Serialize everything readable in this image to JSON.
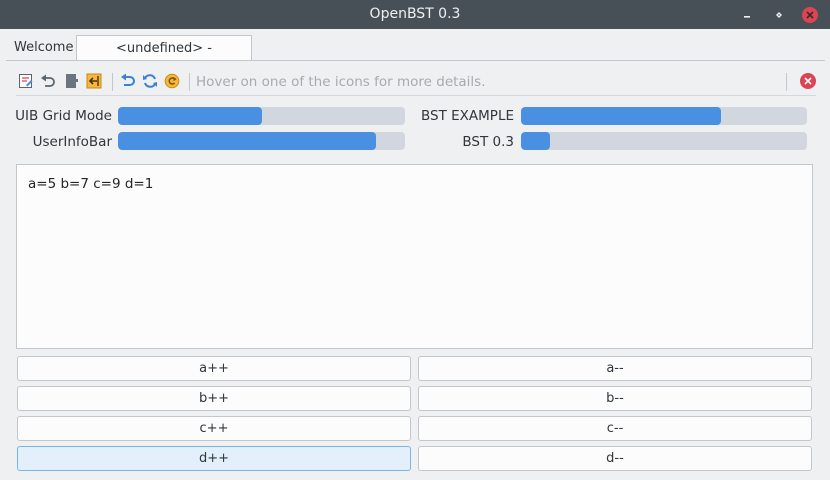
{
  "window": {
    "title": "OpenBST 0.3"
  },
  "tabs": [
    {
      "label": "Welcome"
    },
    {
      "label": "<undefined> - <unknown>"
    }
  ],
  "toolbar": {
    "hint": "Hover on one of the icons for more details.",
    "icons": [
      "save-icon",
      "undo-icon",
      "document-icon",
      "import-icon",
      "reload-icon",
      "refresh-icon",
      "settings-icon"
    ]
  },
  "meters": [
    {
      "label": "UIB Grid Mode",
      "value": 0.5,
      "color": "#4a90e2"
    },
    {
      "label": "BST EXAMPLE",
      "value": 0.7,
      "color": "#4a90e2"
    },
    {
      "label": "UserInfoBar",
      "value": 0.9,
      "color": "#4a90e2"
    },
    {
      "label": "BST 0.3",
      "value": 0.1,
      "color": "#4a90e2"
    }
  ],
  "story_text": "a=5 b=7 c=9 d=1",
  "buttons": [
    {
      "label": "a++"
    },
    {
      "label": "a--"
    },
    {
      "label": "b++"
    },
    {
      "label": "b--"
    },
    {
      "label": "c++"
    },
    {
      "label": "c--"
    },
    {
      "label": "d++"
    },
    {
      "label": "d--"
    }
  ],
  "colors": {
    "titlebar": "#475057",
    "accent": "#4a90e2",
    "close": "#da4453"
  }
}
